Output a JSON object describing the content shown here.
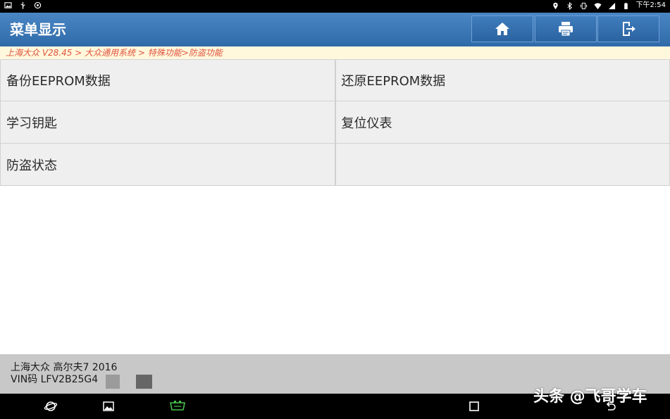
{
  "status_bar": {
    "time": "下午2:54",
    "left_icons": [
      "image-icon",
      "usb-icon",
      "target-icon"
    ],
    "right_icons": [
      "location-icon",
      "bluetooth-icon",
      "vibrate-icon",
      "wifi-icon",
      "signal-icon",
      "battery-icon"
    ]
  },
  "header": {
    "title": "菜单显示",
    "background_color": "#3a76b6",
    "buttons": [
      "home-icon",
      "printer-icon",
      "exit-icon"
    ]
  },
  "breadcrumb": {
    "text": "上海大众 V28.45 > 大众通用系统 > 特殊功能>防盗功能",
    "color": "#e0523e"
  },
  "menu": {
    "rows": [
      [
        "备份EEPROM数据",
        "还原EEPROM数据"
      ],
      [
        "学习钥匙",
        "复位仪表"
      ],
      [
        "防盗状态",
        ""
      ]
    ]
  },
  "vehicle": {
    "model": "上海大众 高尔夫7 2016",
    "vin": "VIN码 LFV2B25G4"
  },
  "nav_bar": {
    "icons": [
      "browser-icon",
      "gallery-icon",
      "vci-icon",
      "recent-apps-icon",
      "back-icon"
    ]
  },
  "watermark": {
    "text": "头条 @飞哥学车"
  }
}
